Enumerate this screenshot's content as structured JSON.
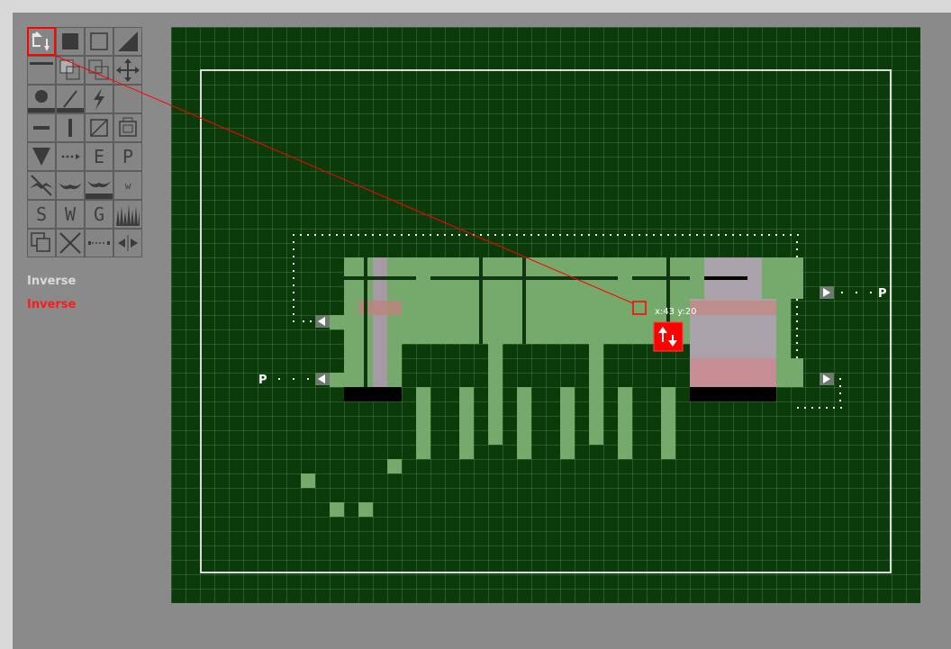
{
  "toolbar": {
    "tools": [
      {
        "name": "download-tool-icon",
        "glyph": "",
        "selected": true
      },
      {
        "name": "fill-square-icon",
        "glyph": ""
      },
      {
        "name": "empty-square-icon",
        "glyph": ""
      },
      {
        "name": "slope-icon",
        "glyph": ""
      },
      {
        "name": "ledge-icon",
        "glyph": ""
      },
      {
        "name": "copy-stamp-icon",
        "glyph": ""
      },
      {
        "name": "duplicate-icon",
        "glyph": ""
      },
      {
        "name": "move-arrows-icon",
        "glyph": ""
      },
      {
        "name": "circle-brush-icon",
        "glyph": ""
      },
      {
        "name": "diagonal-line-icon",
        "glyph": ""
      },
      {
        "name": "lightning-icon",
        "glyph": ""
      },
      {
        "name": "empty-tool-icon",
        "glyph": ""
      },
      {
        "name": "horizontal-bar-icon",
        "glyph": ""
      },
      {
        "name": "vertical-bar-icon",
        "glyph": ""
      },
      {
        "name": "hatch-square-icon",
        "glyph": ""
      },
      {
        "name": "shelter-icon",
        "glyph": ""
      },
      {
        "name": "spike-down-icon",
        "glyph": ""
      },
      {
        "name": "dotted-arrow-icon",
        "glyph": ""
      },
      {
        "name": "letter-e-tool",
        "glyph": "E"
      },
      {
        "name": "letter-p-tool",
        "glyph": "P"
      },
      {
        "name": "bat-icon",
        "glyph": ""
      },
      {
        "name": "bird-icon",
        "glyph": ""
      },
      {
        "name": "bird-platform-icon",
        "glyph": ""
      },
      {
        "name": "letter-w-small-tool",
        "glyph": "w"
      },
      {
        "name": "letter-s-tool",
        "glyph": "S"
      },
      {
        "name": "letter-w-tool",
        "glyph": "W"
      },
      {
        "name": "letter-g-tool",
        "glyph": "G"
      },
      {
        "name": "grass-icon",
        "glyph": ""
      },
      {
        "name": "stack-icon",
        "glyph": ""
      },
      {
        "name": "cross-icon",
        "glyph": ""
      },
      {
        "name": "dashed-range-icon",
        "glyph": ""
      },
      {
        "name": "scroll-arrows-icon",
        "glyph": ""
      }
    ]
  },
  "inverse_off_label": "Inverse",
  "inverse_on_label": "Inverse",
  "cursor": {
    "readout": "x:43 y:20"
  },
  "markers": {
    "left_label": "P",
    "right_label": "P"
  },
  "colors": {
    "background": "#0b3a0b",
    "terrain": "#76a96c",
    "selection": "#ff0000",
    "ui_gray": "#8a8a8a"
  }
}
